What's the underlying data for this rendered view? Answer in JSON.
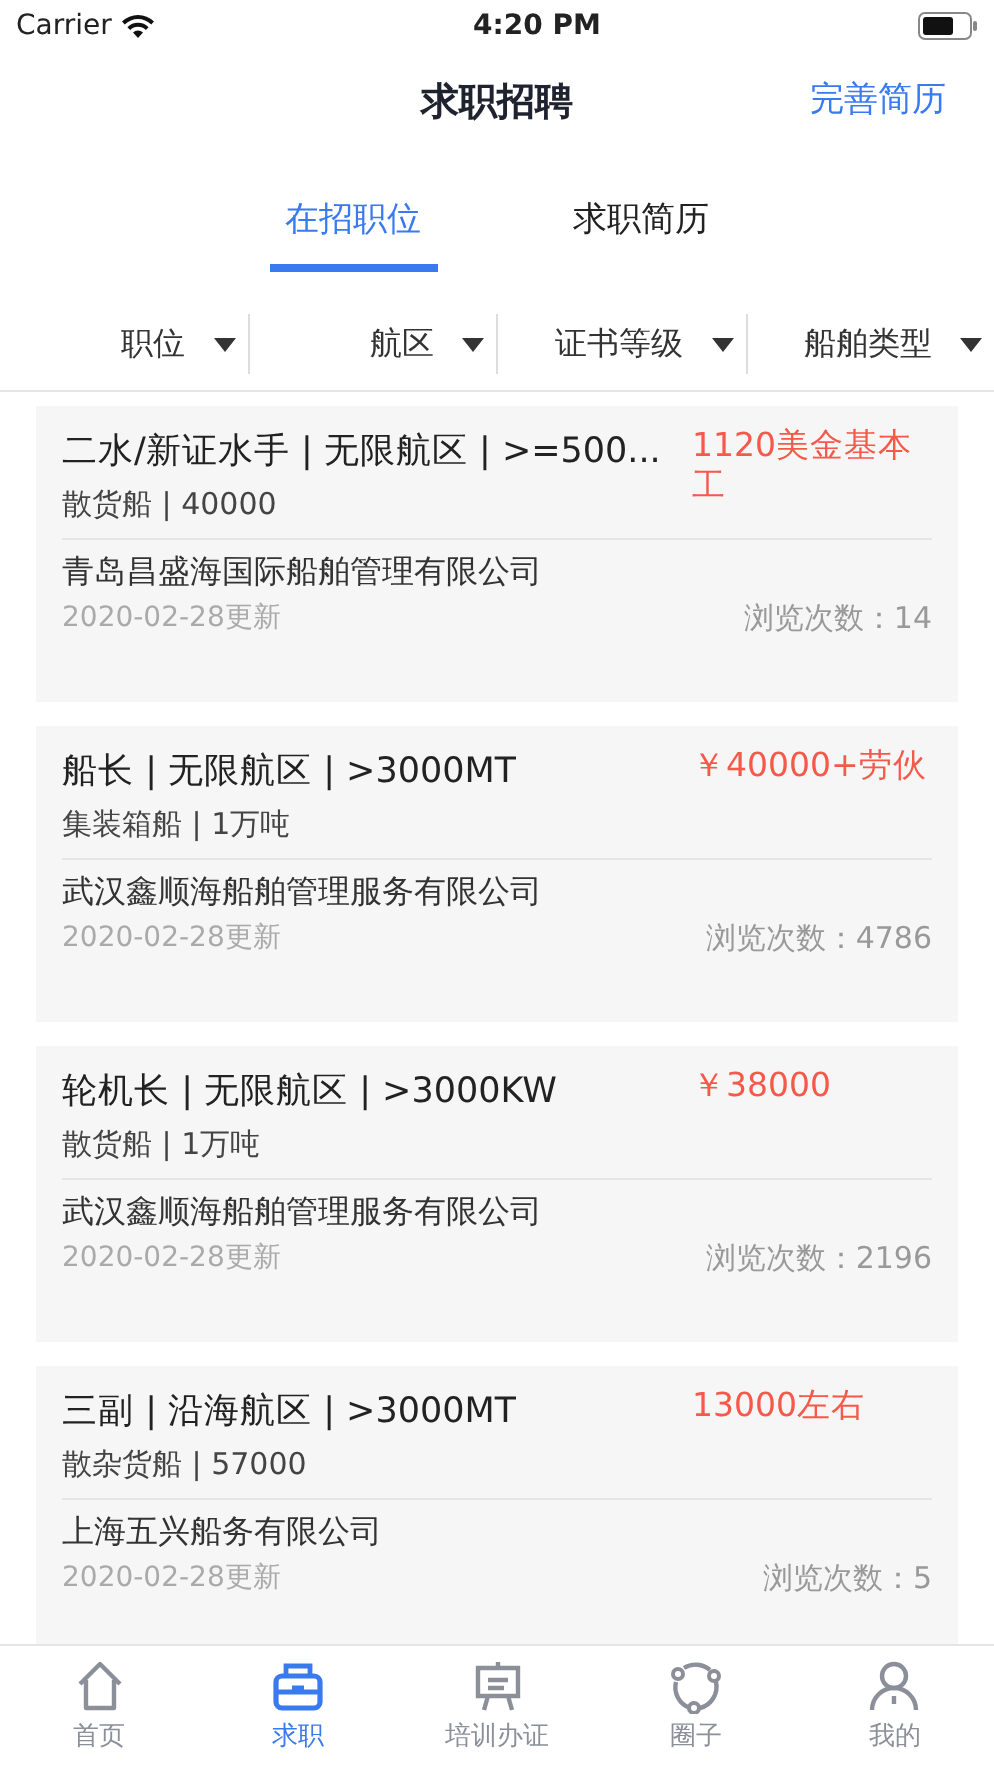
{
  "status_bar": {
    "carrier": "Carrier",
    "time": "4:20 PM"
  },
  "header": {
    "title": "求职招聘",
    "action": "完善简历"
  },
  "tabs": [
    {
      "label": "在招职位",
      "selected": true
    },
    {
      "label": "求职简历",
      "selected": false
    }
  ],
  "filters": [
    "职位",
    "航区",
    "证书等级",
    "船舶类型"
  ],
  "jobs": [
    {
      "title": "二水/新证水手 | 无限航区 | >=500...",
      "salary": "1120美金基本工",
      "ship": "散货船 | 40000",
      "company": "青岛昌盛海国际船舶管理有限公司",
      "updated": "2020-02-28更新",
      "views": "浏览次数：14"
    },
    {
      "title": "船长 | 无限航区 | >3000MT",
      "salary": "￥40000+劳伙",
      "ship": "集装箱船 | 1万吨",
      "company": "武汉鑫顺海船舶管理服务有限公司",
      "updated": "2020-02-28更新",
      "views": "浏览次数：4786"
    },
    {
      "title": "轮机长 | 无限航区 | >3000KW",
      "salary": "￥38000",
      "ship": "散货船 | 1万吨",
      "company": "武汉鑫顺海船舶管理服务有限公司",
      "updated": "2020-02-28更新",
      "views": "浏览次数：2196"
    },
    {
      "title": "三副 | 沿海航区 | >3000MT",
      "salary": "13000左右",
      "ship": "散杂货船 | 57000",
      "company": "上海五兴船务有限公司",
      "updated": "2020-02-28更新",
      "views": "浏览次数：5"
    }
  ],
  "tab_bar": [
    {
      "kind": "home",
      "label": "首页",
      "selected": false
    },
    {
      "kind": "job",
      "label": "求职",
      "selected": true
    },
    {
      "kind": "training",
      "label": "培训办证",
      "selected": false
    },
    {
      "kind": "circle",
      "label": "圈子",
      "selected": false
    },
    {
      "kind": "me",
      "label": "我的",
      "selected": false
    }
  ]
}
